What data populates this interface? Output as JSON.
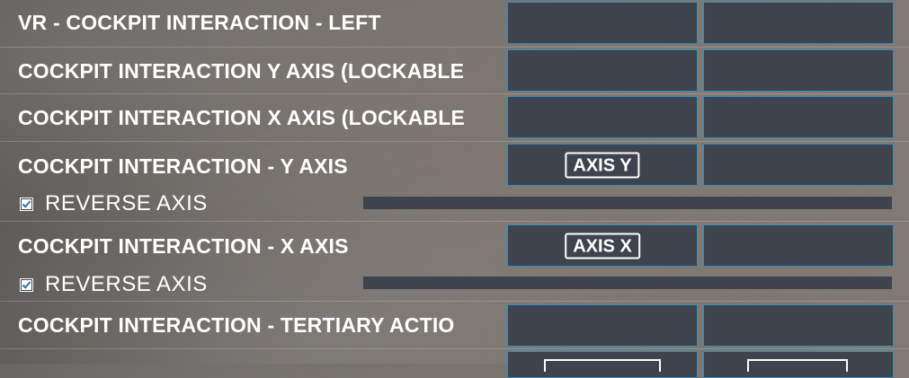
{
  "bindings": [
    {
      "label": "VR - COCKPIT INTERACTION - LEFT",
      "slot_a": "",
      "slot_b": ""
    },
    {
      "label": "COCKPIT INTERACTION Y AXIS (LOCKABLE",
      "slot_a": "",
      "slot_b": ""
    },
    {
      "label": "COCKPIT INTERACTION X AXIS (LOCKABLE",
      "slot_a": "",
      "slot_b": ""
    },
    {
      "label": "COCKPIT INTERACTION - Y AXIS",
      "slot_a": "AXIS Y",
      "slot_b": "",
      "reverse_axis": {
        "label": "REVERSE AXIS",
        "checked": true
      }
    },
    {
      "label": "COCKPIT INTERACTION - X AXIS",
      "slot_a": "AXIS X",
      "slot_b": "",
      "reverse_axis": {
        "label": "REVERSE AXIS",
        "checked": true
      }
    },
    {
      "label": "COCKPIT INTERACTION - TERTIARY ACTIO",
      "slot_a": "",
      "slot_b": ""
    }
  ],
  "colors": {
    "slot_bg": "#3e434d",
    "slot_border": "#2f8fc4",
    "text": "#ffffff"
  }
}
